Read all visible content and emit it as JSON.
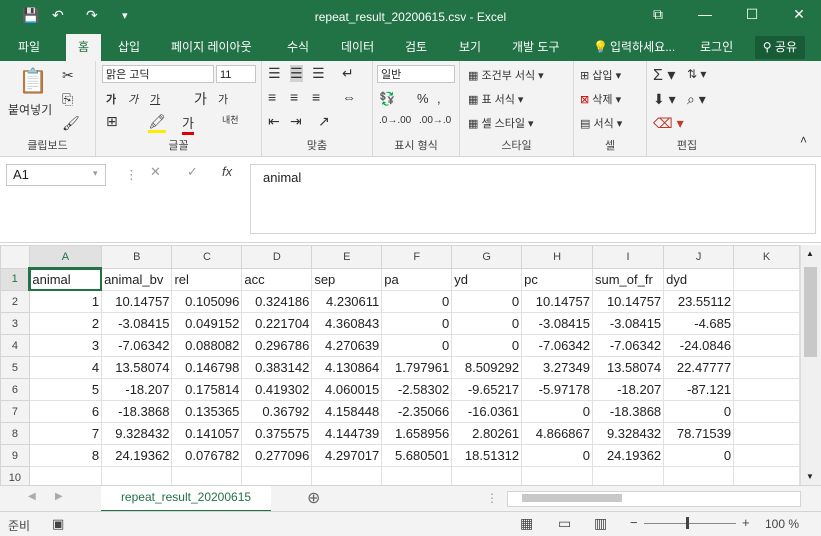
{
  "title": "repeat_result_20200615.csv  -  Excel",
  "quick_access": {
    "save_icon": "💾",
    "undo_icon": "↶",
    "redo_icon": "↷",
    "customize_icon": "▾"
  },
  "window_buttons": {
    "ribbon_options": "⧉",
    "minimize": "—",
    "maximize": "☐",
    "close": "✕"
  },
  "tabs": [
    "파일",
    "홈",
    "삽입",
    "페이지 레이아웃",
    "수식",
    "데이터",
    "검토",
    "보기",
    "개발 도구"
  ],
  "tell_me": "입력하세요...",
  "login": "로그인",
  "share": "공유",
  "ribbon": {
    "clipboard": {
      "label": "클립보드",
      "paste": "붙여넣기"
    },
    "font": {
      "label": "글꼴",
      "font_name": "맑은 고딕",
      "font_size": "11",
      "bold": "가",
      "italic": "가",
      "underline": "가",
      "grow": "가",
      "shrink": "가",
      "fontcolor": "가",
      "phonetic": "내천"
    },
    "alignment": {
      "label": "맞춤"
    },
    "number": {
      "label": "표시 형식",
      "format": "일반"
    },
    "styles": {
      "label": "스타일",
      "conditional": "조건부 서식",
      "table": "표 서식",
      "cell": "셀 스타일"
    },
    "cells": {
      "label": "셀",
      "insert": "삽입",
      "delete": "삭제",
      "format": "서식"
    },
    "editing": {
      "label": "편집"
    }
  },
  "formula": {
    "namebox": "A1",
    "cancel": "✕",
    "enter": "✓",
    "fx": "fx",
    "value": "animal"
  },
  "columns": [
    "A",
    "B",
    "C",
    "D",
    "E",
    "F",
    "G",
    "H",
    "I",
    "J",
    "K"
  ],
  "header_row": [
    "animal",
    "animal_bv",
    "rel",
    "acc",
    "sep",
    "pa",
    "yd",
    "pc",
    "sum_of_fr",
    "dyd"
  ],
  "rows": [
    [
      "1",
      "10.14757",
      "0.105096",
      "0.324186",
      "4.230611",
      "0",
      "0",
      "10.14757",
      "10.14757",
      "23.55112"
    ],
    [
      "2",
      "-3.08415",
      "0.049152",
      "0.221704",
      "4.360843",
      "0",
      "0",
      "-3.08415",
      "-3.08415",
      "-4.685"
    ],
    [
      "3",
      "-7.06342",
      "0.088082",
      "0.296786",
      "4.270639",
      "0",
      "0",
      "-7.06342",
      "-7.06342",
      "-24.0846"
    ],
    [
      "4",
      "13.58074",
      "0.146798",
      "0.383142",
      "4.130864",
      "1.797961",
      "8.509292",
      "3.27349",
      "13.58074",
      "22.47777"
    ],
    [
      "5",
      "-18.207",
      "0.175814",
      "0.419302",
      "4.060015",
      "-2.58302",
      "-9.65217",
      "-5.97178",
      "-18.207",
      "-87.121"
    ],
    [
      "6",
      "-18.3868",
      "0.135365",
      "0.36792",
      "4.158448",
      "-2.35066",
      "-16.0361",
      "0",
      "-18.3868",
      "0"
    ],
    [
      "7",
      "9.328432",
      "0.141057",
      "0.375575",
      "4.144739",
      "1.658956",
      "2.80261",
      "4.866867",
      "9.328432",
      "78.71539"
    ],
    [
      "8",
      "24.19362",
      "0.076782",
      "0.277096",
      "4.297017",
      "5.680501",
      "18.51312",
      "0",
      "24.19362",
      "0"
    ]
  ],
  "row_numbers": [
    "1",
    "2",
    "3",
    "4",
    "5",
    "6",
    "7",
    "8",
    "9",
    "10"
  ],
  "sheet_tab": "repeat_result_20200615",
  "add_sheet": "⊕",
  "status": {
    "ready": "준비",
    "zoom": "100 %",
    "minus": "−",
    "plus": "+"
  }
}
